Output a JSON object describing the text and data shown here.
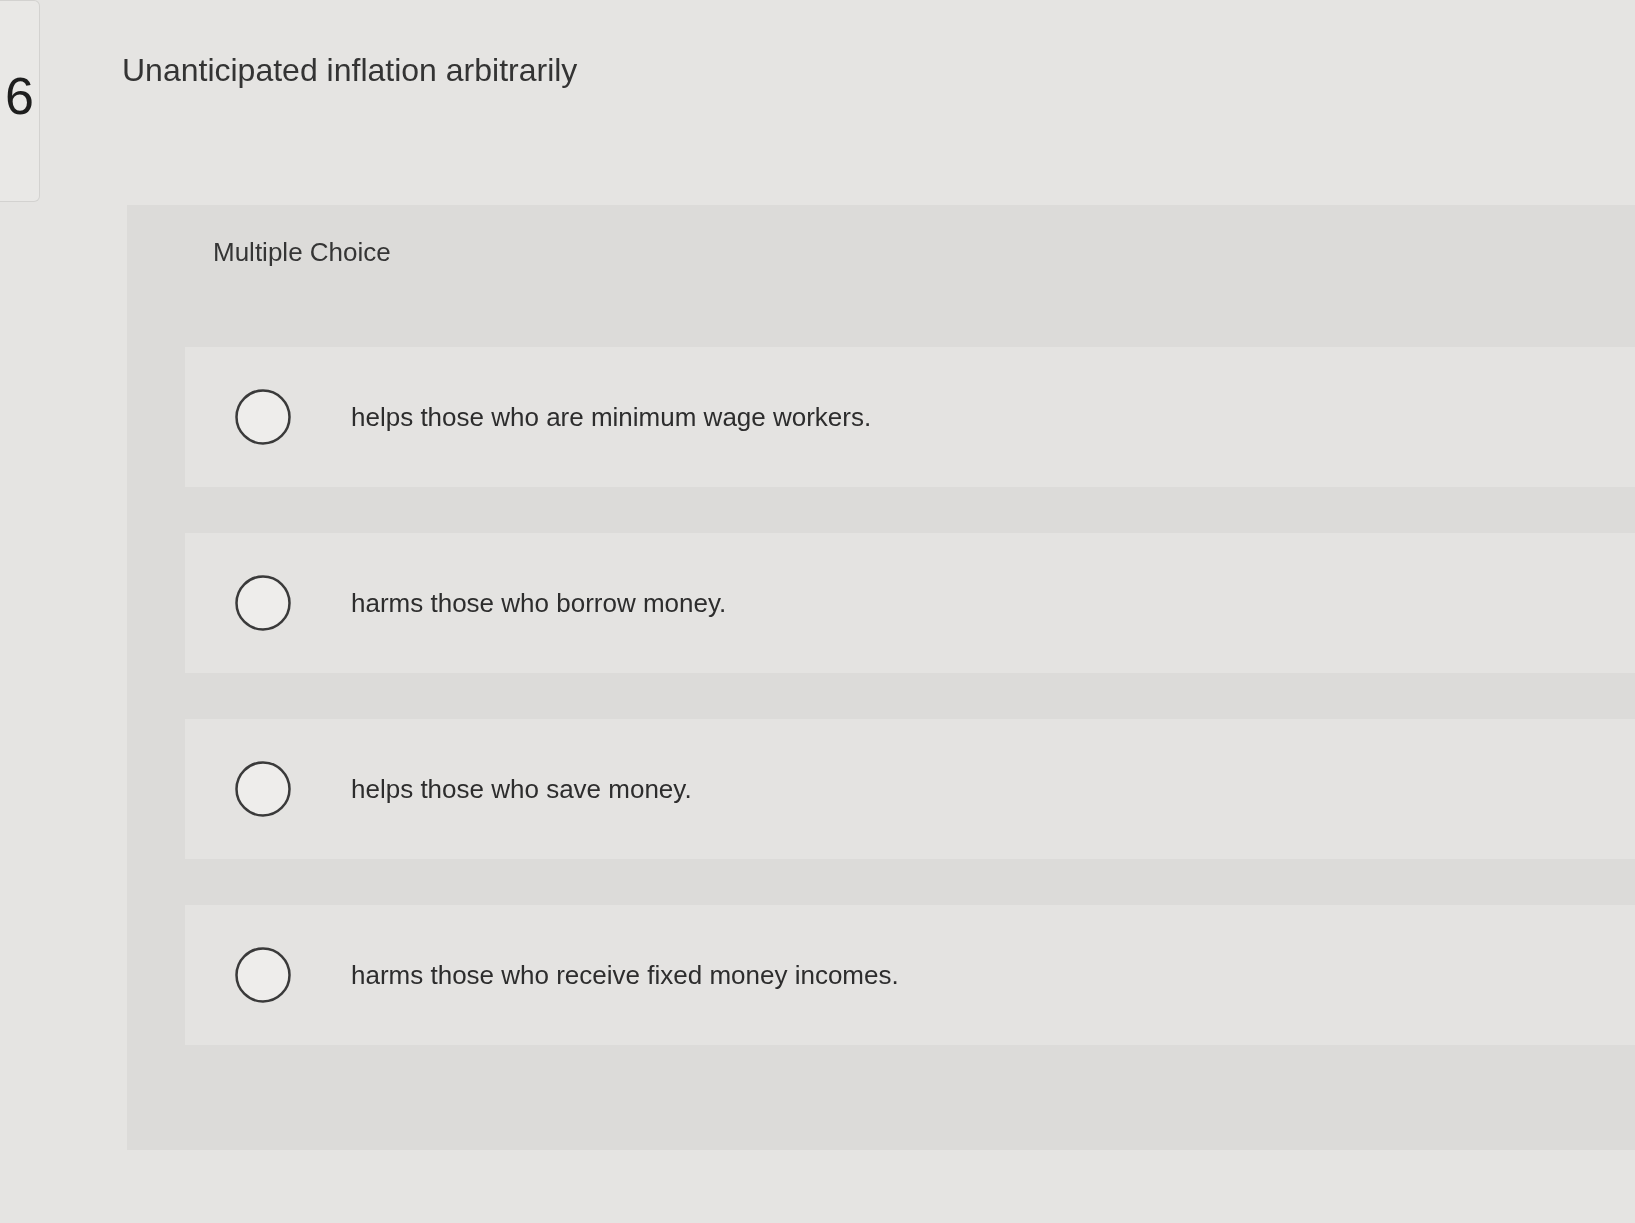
{
  "question": {
    "number": "6",
    "text": "Unanticipated inflation arbitrarily"
  },
  "question_type": "Multiple Choice",
  "options": [
    {
      "text": "helps those who are minimum wage workers.",
      "selected": false
    },
    {
      "text": "harms those who borrow money.",
      "selected": false
    },
    {
      "text": "helps those who save money.",
      "selected": false
    },
    {
      "text": "harms those who receive fixed money incomes.",
      "selected": false
    }
  ]
}
